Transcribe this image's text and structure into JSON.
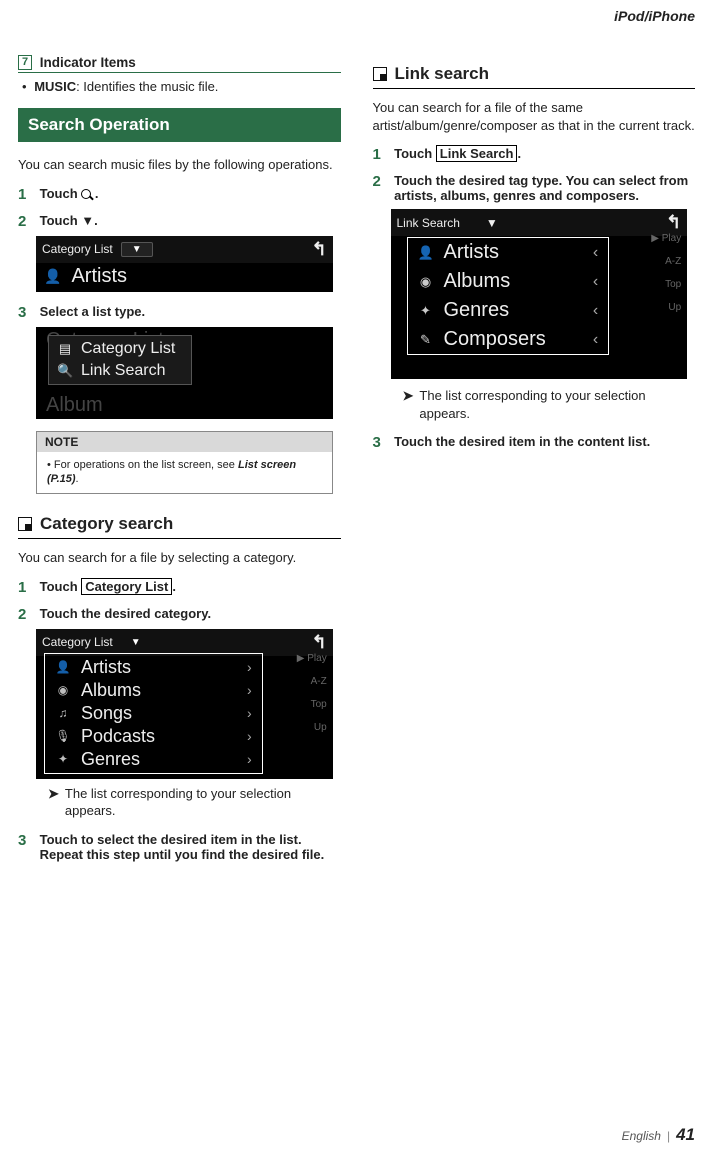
{
  "header": {
    "section": "iPod/iPhone"
  },
  "col1": {
    "indicator": {
      "num": "7",
      "title": "Indicator Items",
      "item_label": "MUSIC",
      "item_desc": ": Identifies the music file."
    },
    "search_op": {
      "bar": "Search Operation",
      "intro": "You can search music files by the following operations.",
      "step1": "Touch ",
      "step1_tail": " .",
      "step2": "Touch ▼.",
      "panel1": {
        "title": "Category List",
        "main": "Artists"
      },
      "step3": "Select a list type.",
      "panel2": {
        "row1": "Category List",
        "row2": "Link Search",
        "faded_top": "Category List",
        "faded_bot": "Album"
      },
      "note_head": "NOTE",
      "note_body_pre": "For operations on the list screen, see ",
      "note_body_bold": "List screen (P.15)",
      "note_body_post": "."
    },
    "category": {
      "head": "Category search",
      "intro": "You can search for a file by selecting a category.",
      "step1_pre": "Touch ",
      "step1_btn": "Category List",
      "step1_post": ".",
      "step2": "Touch the desired category.",
      "panel": {
        "title": "Category List",
        "items": [
          {
            "icon": "person",
            "label": "Artists"
          },
          {
            "icon": "disc",
            "label": "Albums"
          },
          {
            "icon": "note",
            "label": "Songs"
          },
          {
            "icon": "mic",
            "label": "Podcasts"
          },
          {
            "icon": "tag",
            "label": "Genres"
          }
        ],
        "side": [
          "▶ Play",
          "A-Z",
          "Top",
          "Up"
        ]
      },
      "result": "The list corresponding to your selection appears.",
      "step3": "Touch to select the desired item in the list. Repeat this step until you find the desired file."
    }
  },
  "col2": {
    "link": {
      "head": "Link search",
      "intro": "You can search for a file of the same artist/album/genre/composer as that in the current track.",
      "step1_pre": "Touch ",
      "step1_btn": "Link Search",
      "step1_post": ".",
      "step2": "Touch the desired tag type. You can select from artists, albums, genres and composers.",
      "panel": {
        "title": "Link Search",
        "items": [
          {
            "icon": "person",
            "label": "Artists"
          },
          {
            "icon": "disc",
            "label": "Albums"
          },
          {
            "icon": "tag",
            "label": "Genres"
          },
          {
            "icon": "pen",
            "label": "Composers"
          }
        ],
        "side": [
          "▶ Play",
          "A-Z",
          "Top",
          "Up"
        ]
      },
      "result": "The list corresponding to your selection appears.",
      "step3": "Touch the desired item in the content list."
    }
  },
  "footer": {
    "lang": "English",
    "page": "41"
  }
}
